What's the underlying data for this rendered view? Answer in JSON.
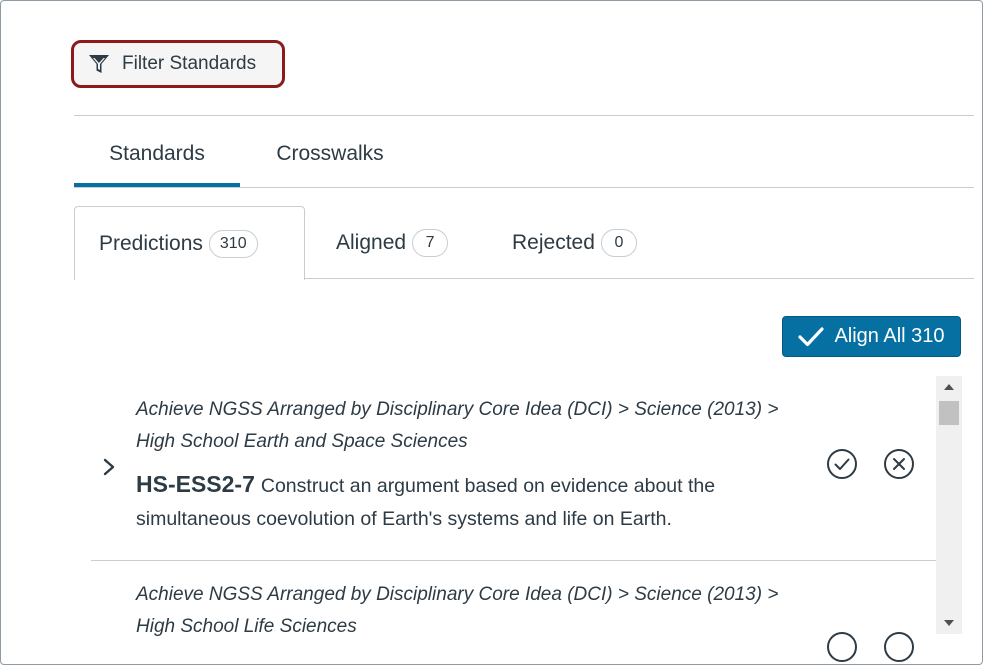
{
  "filter": {
    "label": "Filter Standards",
    "icon": "filter-icon"
  },
  "tabs": [
    {
      "label": "Standards",
      "active": true
    },
    {
      "label": "Crosswalks",
      "active": false
    }
  ],
  "subtabs": [
    {
      "label": "Predictions",
      "count": "310",
      "active": true
    },
    {
      "label": "Aligned",
      "count": "7",
      "active": false
    },
    {
      "label": "Rejected",
      "count": "0",
      "active": false
    }
  ],
  "align_all": {
    "label": "Align All 310",
    "icon": "checkmark-icon"
  },
  "items": [
    {
      "path": "Achieve NGSS Arranged by Disciplinary Core Idea (DCI) > Science (2013) > High School Earth and Space Sciences",
      "code": "HS-ESS2-7",
      "description": "Construct an argument based on evidence about the simultaneous coevolution of Earth's systems and life on Earth."
    },
    {
      "path": "Achieve NGSS Arranged by Disciplinary Core Idea (DCI) > Science (2013) > High School Life Sciences"
    }
  ],
  "colors": {
    "accent": "#0770a3",
    "highlight_border": "#8b1a1a",
    "text": "#2d3b45",
    "divider": "#c7cdd1"
  }
}
